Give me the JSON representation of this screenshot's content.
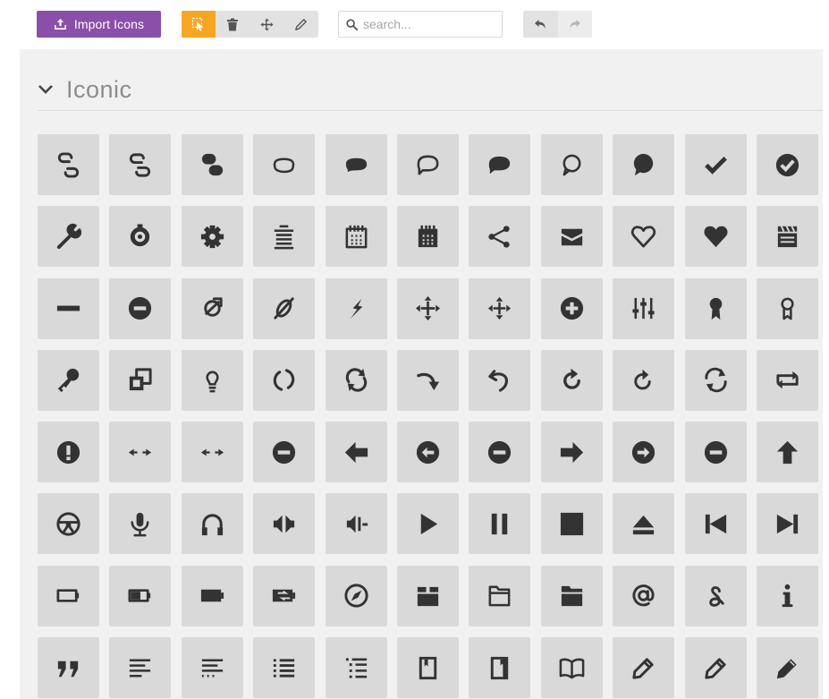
{
  "toolbar": {
    "import_label": "Import Icons",
    "tools": [
      {
        "name": "select-tool",
        "icon": "pointer-icon",
        "active": true
      },
      {
        "name": "delete-tool",
        "icon": "trash-icon",
        "active": false
      },
      {
        "name": "move-tool",
        "icon": "move-icon",
        "active": false
      },
      {
        "name": "edit-tool",
        "icon": "pencil-icon",
        "active": false
      }
    ],
    "search": {
      "placeholder": "search...",
      "value": ""
    },
    "history": [
      {
        "name": "undo",
        "icon": "undo-icon",
        "enabled": true
      },
      {
        "name": "redo",
        "icon": "redo-icon",
        "enabled": false
      }
    ]
  },
  "icon_set": {
    "title": "Iconic",
    "expanded": true,
    "icon_color": "#333333",
    "tile_color": "#d9d9d9",
    "rows": [
      [
        "link-intact",
        "link-intact-alt",
        "link-broken-fill",
        "chat-bubble-outline",
        "chat-bubble-fill",
        "speech-outline",
        "speech-fill",
        "comment-outline",
        "comment-fill",
        "check",
        "check-circle"
      ],
      [
        "wrench",
        "cog-ring",
        "cog",
        "list-header",
        "calendar-outline",
        "calendar-fill",
        "share",
        "envelope",
        "heart-outline",
        "heart-fill",
        "clapperboard"
      ],
      [
        "minus",
        "minus-circle",
        "link-circle-outline",
        "link-diagonal-outline",
        "lightning",
        "move-arrows",
        "move-arrows-alt",
        "plus-circle",
        "sliders",
        "award-fill",
        "award-outline"
      ],
      [
        "key",
        "layers",
        "lightbulb",
        "reload-outline",
        "reload-arrows",
        "redo-curve",
        "undo-curve",
        "refresh",
        "refresh-alt",
        "loop-arrows",
        "loop-square"
      ],
      [
        "info-circle",
        "arrows-horizontal",
        "arrows-horizontal-alt",
        "minus-circle",
        "arrow-left",
        "arrow-left-circle",
        "minus-circle",
        "arrow-right",
        "arrow-right-circle",
        "minus-circle",
        "arrow-up"
      ],
      [
        "steering-wheel",
        "microphone",
        "headphones",
        "volume",
        "volume-low",
        "play",
        "pause",
        "stop",
        "eject",
        "skip-previous",
        "skip-next"
      ],
      [
        "battery-empty",
        "battery-half",
        "battery-full",
        "battery-charging",
        "compass",
        "box",
        "folder-outline",
        "folder-fill",
        "at-sign",
        "ampersand",
        "info"
      ],
      [
        "quote",
        "text-align-left",
        "text-align-left-short",
        "list-bullets",
        "list-indent",
        "book-closed",
        "book-bookmark",
        "book-open",
        "pencil-outline",
        "pencil-alt",
        "pencil-fill"
      ]
    ]
  }
}
